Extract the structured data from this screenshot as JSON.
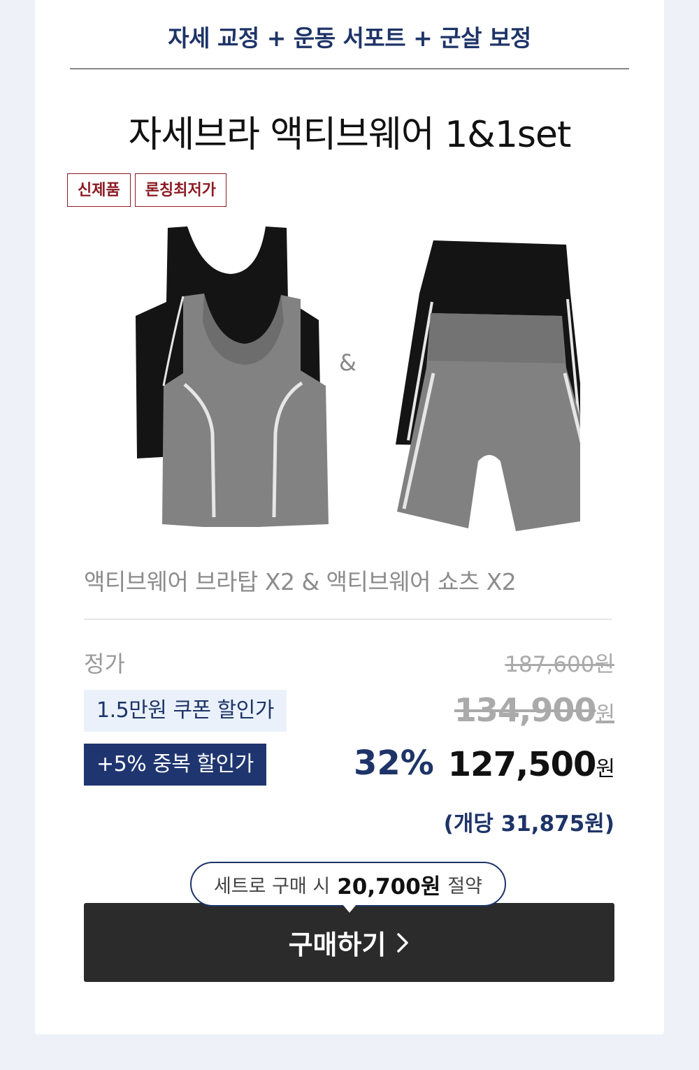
{
  "tagline": "자세 교정 + 운동 서포트 + 군살 보정",
  "product_title": "자세브라 액티브웨어 1&1set",
  "badges": [
    "신제품",
    "론칭최저가"
  ],
  "image_ampersand": "&",
  "description": "액티브웨어 브라탑 X2 & 액티브웨어 쇼츠 X2",
  "pricing": {
    "regular_label": "정가",
    "regular_price": "187,600원",
    "coupon_label": "1.5만원 쿠폰 할인가",
    "coupon_price": "134,900",
    "coupon_price_unit": "원",
    "extra_label": "+5% 중복 할인가",
    "discount_percent": "32%",
    "final_price": "127,500",
    "final_price_unit": "원",
    "unit_price": "(개당 31,875원)"
  },
  "savings_bubble": {
    "prefix": "세트로 구매 시",
    "amount": "20,700원",
    "suffix": "절약"
  },
  "buy_button": {
    "label": "구매하기",
    "icon": "chevron-right-icon"
  },
  "colors": {
    "navy": "#1e3468",
    "badge_red": "#8b1a22",
    "button_bg": "#2b2b2b",
    "coupon_bg": "#eaf1fb"
  }
}
